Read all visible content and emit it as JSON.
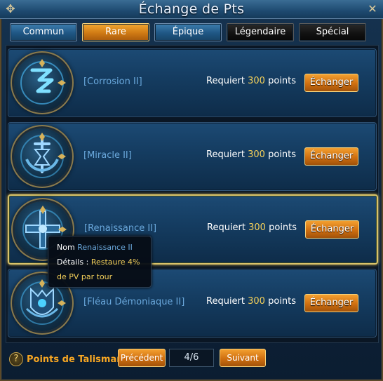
{
  "window": {
    "title": "Échange de Pts"
  },
  "tabs": [
    {
      "label": "Commun"
    },
    {
      "label": "Rare"
    },
    {
      "label": "Épique"
    },
    {
      "label": "Légendaire"
    },
    {
      "label": "Spécial"
    }
  ],
  "items": [
    {
      "name": "[Corrosion II]",
      "requires": "Requiert",
      "points": "300",
      "unit": "points",
      "button": "Échanger",
      "icon": "corrosion-talisman-icon"
    },
    {
      "name": "[Miracle II]",
      "requires": "Requiert",
      "points": "300",
      "unit": "points",
      "button": "Échanger",
      "icon": "miracle-talisman-icon"
    },
    {
      "name": "[Renaissance II]",
      "requires": "Requiert",
      "points": "300",
      "unit": "points",
      "button": "Échanger",
      "icon": "renaissance-talisman-icon"
    },
    {
      "name": "[Fléau Démoniaque II]",
      "requires": "Requiert",
      "points": "300",
      "unit": "points",
      "button": "Échanger",
      "icon": "demon-scourge-talisman-icon"
    }
  ],
  "tooltip": {
    "name_label": "Nom",
    "name_value": "Renaissance II",
    "details_label": "Détails :",
    "details_value_1": "Restaure 4%",
    "details_value_2": "de PV par tour"
  },
  "footer": {
    "label": "Points de Talisman",
    "prev": "Précédent",
    "page": "4/6",
    "next": "Suivant"
  },
  "colors": {
    "accent": "#f6a623",
    "points": "#f4d05a",
    "link": "#6aa8dc"
  }
}
